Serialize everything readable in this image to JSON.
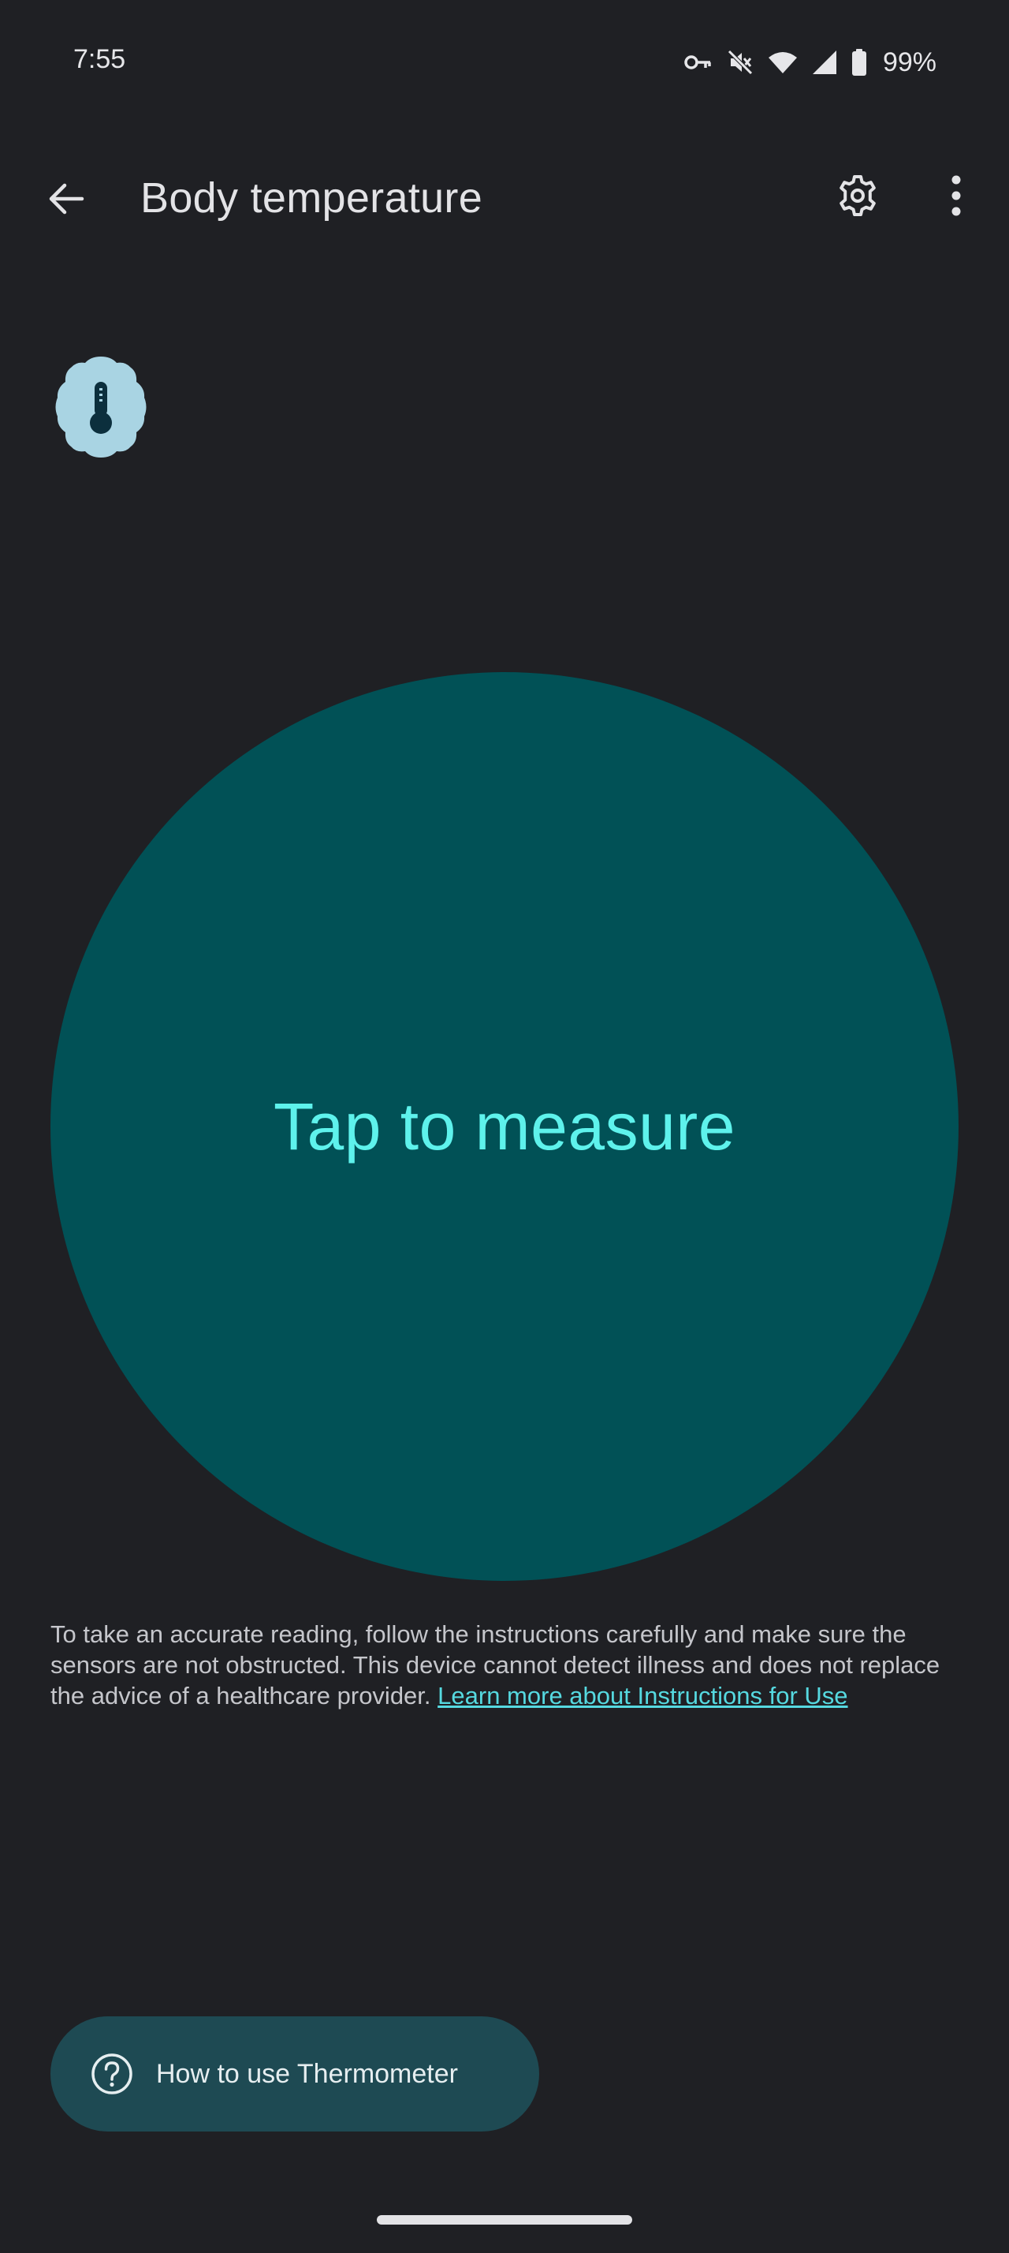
{
  "status_bar": {
    "time": "7:55",
    "battery": "99%",
    "icons": [
      "vpn-key-icon",
      "mute-icon",
      "wifi-icon",
      "signal-icon",
      "battery-icon"
    ]
  },
  "app_bar": {
    "title": "Body temperature",
    "back_icon": "arrow-back-icon",
    "settings_icon": "gear-icon",
    "more_icon": "more-vert-icon"
  },
  "badge": {
    "icon": "thermometer-icon"
  },
  "measure": {
    "label": "Tap to measure"
  },
  "disclaimer": {
    "text": "To take an accurate reading, follow the instructions carefully and make sure the sensors are not obstructed. This device cannot detect illness and does not replace the advice of a healthcare provider.",
    "link": "Learn more about Instructions for Use"
  },
  "help_button": {
    "label": "How to use Thermometer",
    "icon": "help-circle-icon"
  },
  "colors": {
    "background": "#1f2024",
    "circle": "#015156",
    "circle_text": "#5ef2ec",
    "link": "#56d9e0",
    "help_button": "#1e4a53"
  }
}
